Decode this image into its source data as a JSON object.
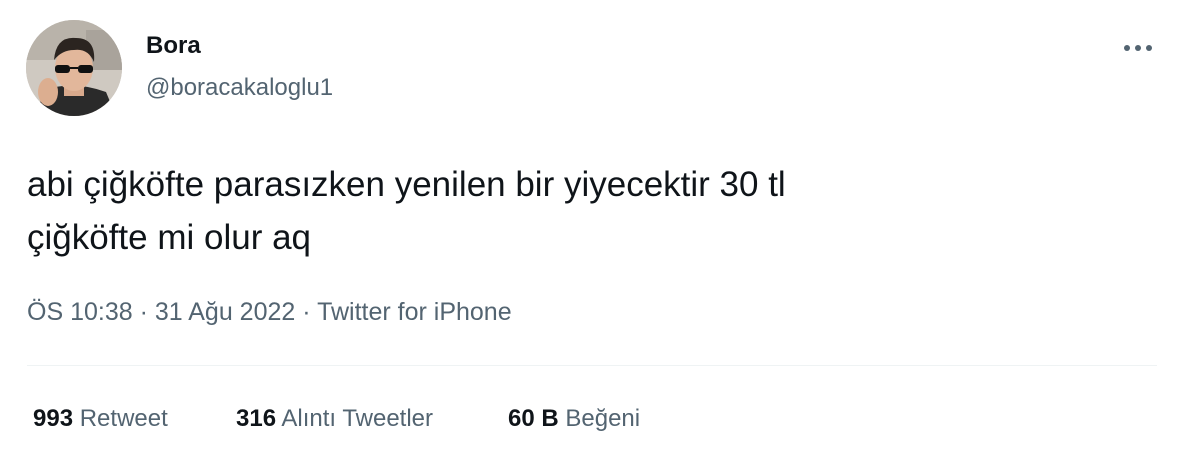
{
  "author": {
    "display_name": "Bora",
    "handle": "@boracakaloglu1",
    "avatar_icon": "user-avatar-photo"
  },
  "menu": {
    "icon": "more-horizontal-icon"
  },
  "tweet": {
    "text": "abi çiğköfte parasızken yenilen bir yiyecektir 30 tl\nçiğköfte mi olur aq"
  },
  "meta": {
    "time": "ÖS 10:38",
    "separator": "·",
    "date": "31 Ağu 2022",
    "source": "Twitter for iPhone"
  },
  "stats": {
    "retweets": {
      "count": "993",
      "label": "Retweet"
    },
    "quotes": {
      "count": "316",
      "label": "Alıntı Tweetler"
    },
    "likes": {
      "count": "60 B",
      "label": "Beğeni"
    }
  },
  "colors": {
    "text_primary": "#0f1419",
    "text_secondary": "#536471",
    "divider": "#eff3f4"
  }
}
